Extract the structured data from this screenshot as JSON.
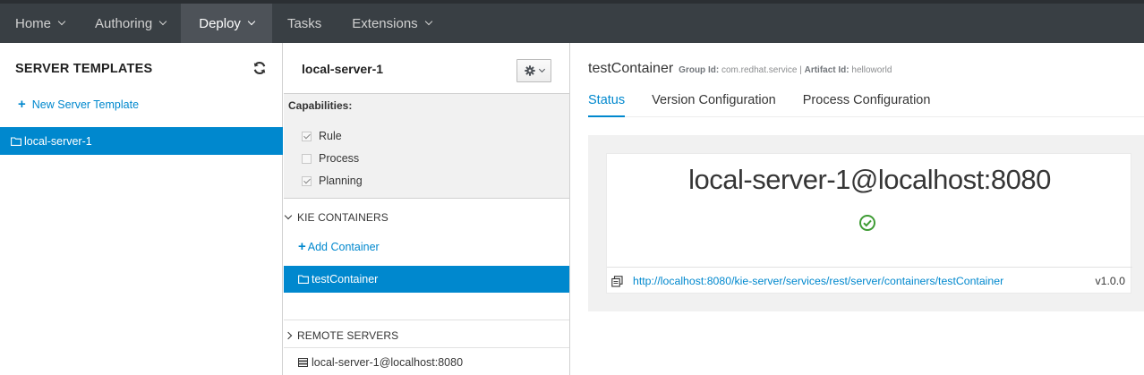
{
  "nav": {
    "items": [
      {
        "label": "Home",
        "dropdown": true
      },
      {
        "label": "Authoring",
        "dropdown": true
      },
      {
        "label": "Deploy",
        "dropdown": true,
        "active": true
      },
      {
        "label": "Tasks",
        "dropdown": false
      },
      {
        "label": "Extensions",
        "dropdown": true
      }
    ]
  },
  "templates": {
    "title": "SERVER TEMPLATES",
    "new_label": "New Server Template",
    "items": [
      "local-server-1"
    ]
  },
  "server": {
    "title": "local-server-1",
    "capabilities_label": "Capabilities:",
    "capabilities": [
      {
        "label": "Rule",
        "checked": true
      },
      {
        "label": "Process",
        "checked": false
      },
      {
        "label": "Planning",
        "checked": true
      }
    ],
    "kie_label": "KIE CONTAINERS",
    "add_container_label": "Add Container",
    "containers": [
      "testContainer"
    ],
    "remote_label": "REMOTE SERVERS",
    "remote_servers": [
      "local-server-1@localhost:8080"
    ]
  },
  "container": {
    "name": "testContainer",
    "group_label": "Group Id:",
    "group_id": "com.redhat.service",
    "sep": "|",
    "artifact_label": "Artifact Id:",
    "artifact_id": "helloworld",
    "tabs": [
      "Status",
      "Version Configuration",
      "Process Configuration"
    ],
    "status": {
      "host": "local-server-1@localhost:8080",
      "url": "http://localhost:8080/kie-server/services/rest/server/containers/testContainer",
      "version": "v1.0.0"
    }
  },
  "colors": {
    "accent": "#0088ce",
    "nav_bg": "#393f44",
    "ok": "#3f9c35"
  }
}
